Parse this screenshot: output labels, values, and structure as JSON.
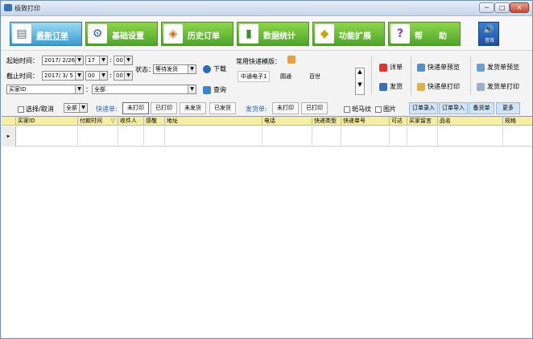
{
  "window": {
    "title": "极致打印",
    "buttons": {
      "minimize": "─",
      "maximize": "□",
      "close": "✕"
    }
  },
  "ribbon": {
    "buttons": [
      {
        "label": "最新订单",
        "icon": "monitor-icon",
        "glyph": "▤",
        "active": true
      },
      {
        "label": "基础设置",
        "icon": "gear-icon",
        "glyph": "⚙",
        "active": false
      },
      {
        "label": "历史订单",
        "icon": "history-icon",
        "glyph": "◈",
        "active": false
      },
      {
        "label": "数据统计",
        "icon": "bar-chart-icon",
        "glyph": "▮",
        "active": false
      },
      {
        "label": "功能扩展",
        "icon": "extension-icon",
        "glyph": "◆",
        "active": false
      },
      {
        "label": "帮　　助",
        "icon": "help-icon",
        "glyph": "?",
        "active": false
      }
    ],
    "sound": {
      "glyph": "🔊",
      "label": "音效"
    }
  },
  "filters": {
    "start_time_label": "起始时间：",
    "start_date": "2017/ 2/26",
    "start_hour": "17",
    "start_minute": "00",
    "end_time_label": "截止时间：",
    "end_date": "2017/ 3/ 5",
    "end_hour": "00",
    "end_minute": "00",
    "colon": ":",
    "status_label": "状态：",
    "status_value": "等待发货",
    "download_label": "下载",
    "field_select": "买家ID",
    "colon_label": "：",
    "field_value": "全部",
    "query_label": "查询",
    "template_label": "常用快递模版：",
    "templates": [
      "中通电子1",
      "圆通",
      "百世"
    ],
    "detail_label": "详单",
    "ship_label": "发货",
    "express_preview": "快递单预览",
    "express_print": "快递单打印",
    "delivery_preview": "发货单预览",
    "delivery_print": "发货单打印"
  },
  "toolbar2": {
    "select_all": "选择/取消",
    "scope": "全部",
    "express_label": "快递单:",
    "express_tabs": [
      "未打印",
      "已打印",
      "未发货",
      "已发货"
    ],
    "delivery_label": "发货单:",
    "delivery_tabs": [
      "未打印",
      "已打印"
    ],
    "barcode": "斑马纹",
    "image": "图片",
    "right_tabs": [
      "订单录入",
      "订单导入",
      "备货单",
      "更多"
    ]
  },
  "grid": {
    "columns": [
      "买家ID",
      "付款时间",
      "收件人",
      "感敬",
      "地址",
      "电话",
      "快递类型",
      "快递单号",
      "可达",
      "买家留言",
      "品名",
      "规格"
    ],
    "sort_indicator": "▽",
    "row_indicator": "▸"
  }
}
